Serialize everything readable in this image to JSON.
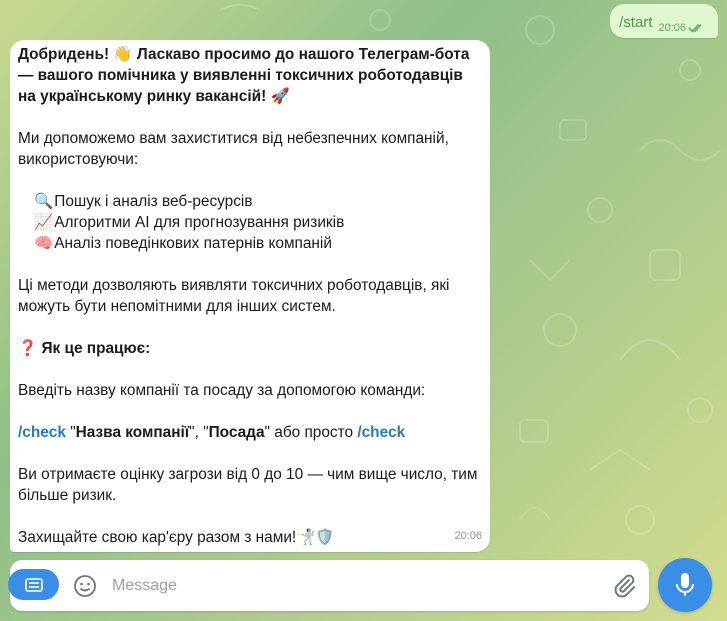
{
  "outgoing": {
    "text": "/start",
    "time": "20:06"
  },
  "incoming": {
    "greeting_emoji": "👋",
    "greeting_part1": "Добридень!",
    "greeting_part2": "Ласкаво просимо до нашого Телеграм-бота — вашого помічника у виявленні токсичних роботодавців на українському ринку вакансій!",
    "rocket_emoji": "🚀",
    "intro": "Ми допоможемо вам захиститися від небезпечних компаній, використовуючи:",
    "features": [
      {
        "emoji": "🔍",
        "text": "Пошук і аналіз веб-ресурсів"
      },
      {
        "emoji": "📈",
        "text": "Алгоритми AI для прогнозування ризиків"
      },
      {
        "emoji": "🧠",
        "text": "Аналіз поведінкових патернів компаній"
      }
    ],
    "methods": "Ці методи дозволяють виявляти токсичних роботодавців, які можуть бути непомітними для інших систем.",
    "how_emoji": "❓",
    "how_title": "Як це працює:",
    "instruction": "Введіть назву компанії та посаду за допомогою команди:",
    "cmd": "/check",
    "q1": "\"",
    "company_placeholder": "Назва компанії",
    "sep": "\", \"",
    "position_placeholder": "Посада",
    "q2": "\" або просто ",
    "rating": "Ви отримаєте оцінку загрози від 0 до 10 — чим вище число, тим більше ризик.",
    "closing": "Захищайте свою кар'єру разом з нами!",
    "closing_emojis": "🤺🛡️",
    "time": "20:06"
  },
  "composer": {
    "placeholder": "Message"
  },
  "colors": {
    "accent": "#3b8ee6",
    "outgoing_bubble": "#e1f7cf",
    "link": "#2a7ab8"
  },
  "icons": [
    "menu-icon",
    "emoji-icon",
    "attach-icon",
    "mic-icon",
    "double-check-icon"
  ]
}
